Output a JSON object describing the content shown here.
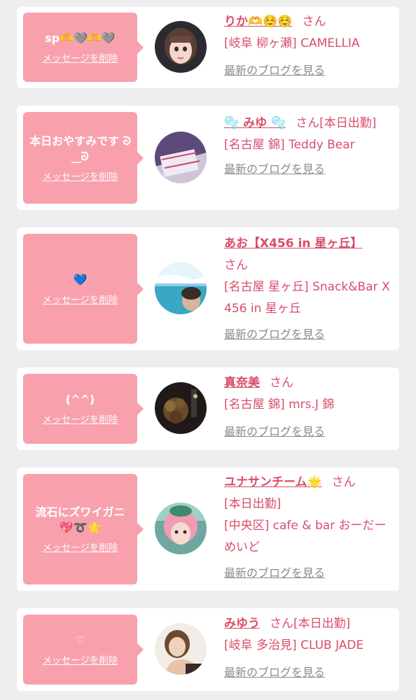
{
  "colors": {
    "accent": "#d94d6a",
    "bubble": "#f8a1ad",
    "link_gray": "#8a8a8a",
    "background": "#eeeeee"
  },
  "common": {
    "delete_label": "メッセージを削除",
    "blog_label": "最新のブログを見る",
    "san": "さん"
  },
  "cards": [
    {
      "message": "sp🫶🩶🫶🩶",
      "name": "りか🫶☺️☺️",
      "lines": [
        "[岐阜 柳ヶ瀬] CAMELLIA"
      ]
    },
    {
      "message": "本日おやすみです ᘐ‿ᘐ",
      "name": "🫧 みゆ 🫧",
      "status": "[本日出勤]",
      "lines": [
        "[名古屋 錦] Teddy Bear"
      ]
    },
    {
      "message": "💙",
      "name": "あお【X456 in 星ヶ丘】",
      "lines": [
        "[名古屋 星ヶ丘] Snack&Bar X 456 in 星ヶ丘"
      ]
    },
    {
      "message": "(^^)",
      "name": "真奈美",
      "lines": [
        "[名古屋 錦] mrs.J 錦"
      ]
    },
    {
      "message": "流石にズワイガニ💖➰🌟",
      "name": "ユナサンチーム🌟",
      "lines": [
        "[本日出勤]",
        "[中央区] cafe & bar おーだーめいど"
      ]
    },
    {
      "message": "♡",
      "name": "みゆう",
      "status": "[本日出勤]",
      "lines": [
        "[岐阜 多治見] CLUB JADE"
      ]
    }
  ]
}
